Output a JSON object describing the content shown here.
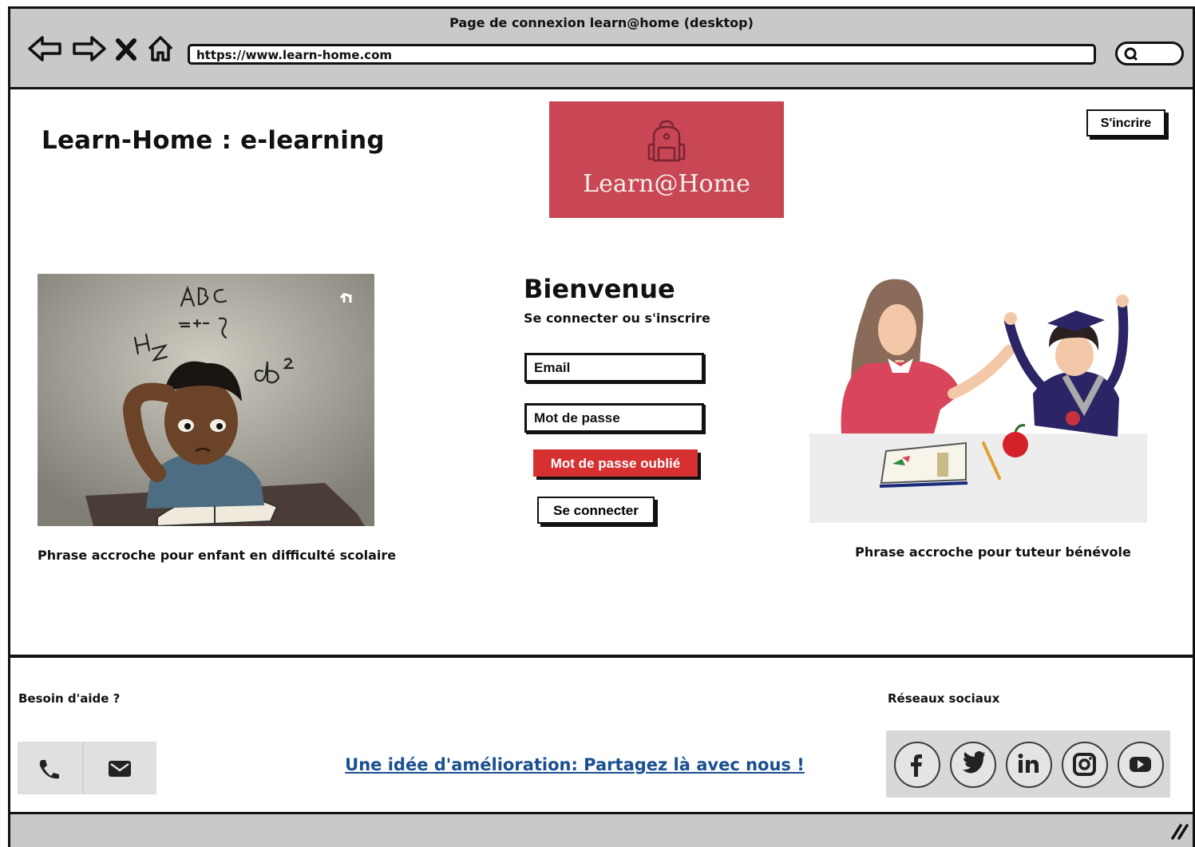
{
  "window": {
    "title": "Page de connexion learn@home (desktop)"
  },
  "browser": {
    "url": "https://www.learn-home.com",
    "icons": [
      "back-arrow-icon",
      "forward-arrow-icon",
      "close-icon",
      "home-icon",
      "search-icon"
    ]
  },
  "header": {
    "site_title": "Learn-Home : e-learning",
    "logo_text": "Learn@Home",
    "signup_label": "S'incrire"
  },
  "login": {
    "welcome": "Bienvenue",
    "subtitle": "Se connecter ou s'inscrire",
    "email_placeholder": "Email",
    "password_placeholder": "Mot de passe",
    "forgot_label": "Mot de passe oublié",
    "login_label": "Se connecter"
  },
  "left_panel": {
    "caption": "Phrase accroche pour enfant en difficulté scolaire"
  },
  "right_panel": {
    "caption": "Phrase accroche pour tuteur bénévole"
  },
  "footer": {
    "help_title": "Besoin d'aide ?",
    "feedback_link": "Une idée d'amélioration: Partagez là avec nous !",
    "social_title": "Réseaux sociaux",
    "social_icons": [
      "facebook-icon",
      "twitter-icon",
      "linkedin-icon",
      "instagram-icon",
      "youtube-icon"
    ]
  },
  "colors": {
    "logo_bg": "#c94755",
    "forgot_button": "#d63030",
    "link": "#1a4f91",
    "chrome": "#c9c9c9"
  }
}
